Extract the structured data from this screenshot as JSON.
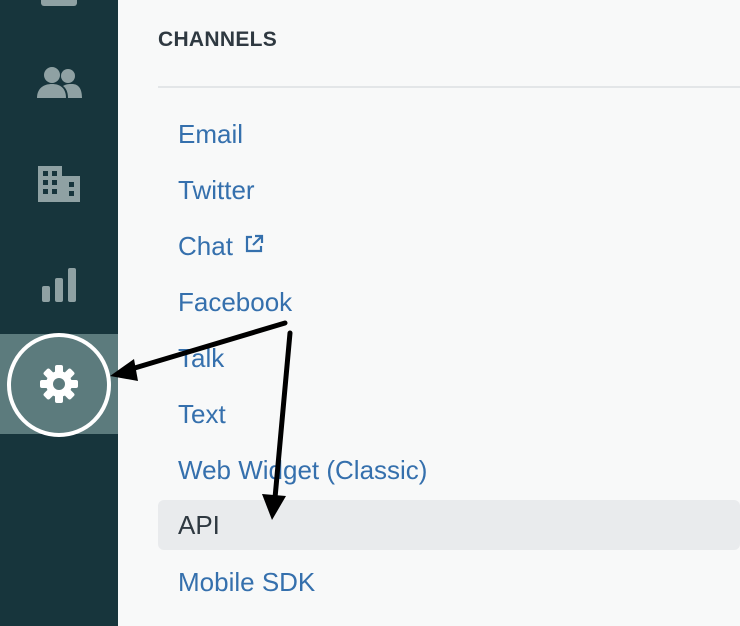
{
  "sidebar": {
    "items": [
      {
        "icon": "home-icon"
      },
      {
        "icon": "users-icon"
      },
      {
        "icon": "building-icon"
      },
      {
        "icon": "bar-chart-icon"
      },
      {
        "icon": "gear-icon",
        "active": true
      }
    ],
    "active_color": "#5c7b7d",
    "background": "#17353c"
  },
  "channels": {
    "heading": "CHANNELS",
    "items": [
      {
        "label": "Email"
      },
      {
        "label": "Twitter"
      },
      {
        "label": "Chat",
        "icon": "external-link-icon"
      },
      {
        "label": "Facebook"
      },
      {
        "label": "Talk"
      },
      {
        "label": "Text"
      },
      {
        "label": "Web Widget (Classic)"
      },
      {
        "label": "API",
        "selected": true
      },
      {
        "label": "Mobile SDK"
      }
    ],
    "link_color": "#3570ad"
  },
  "annotation": {
    "arrow_color": "#000000"
  }
}
